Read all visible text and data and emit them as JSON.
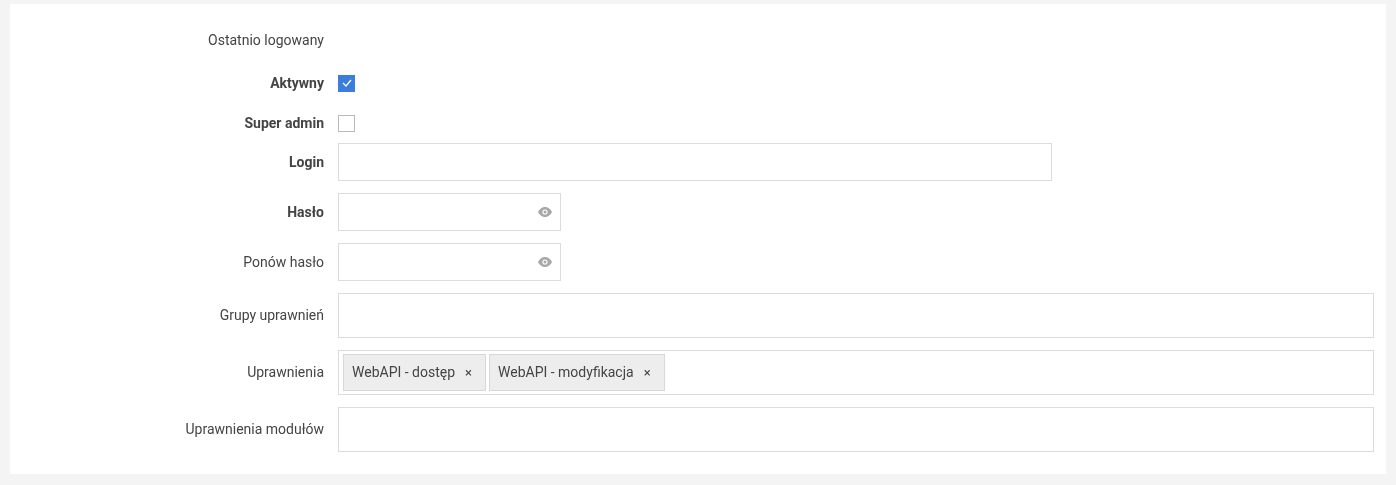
{
  "form": {
    "fields": [
      {
        "kind": "text",
        "label": "Ostatnio logowany",
        "required": false
      },
      {
        "kind": "checkbox",
        "label": "Aktywny",
        "required": true,
        "checked": true
      },
      {
        "kind": "checkbox",
        "label": "Super admin",
        "required": true,
        "checked": false
      },
      {
        "kind": "input",
        "label": "Login",
        "required": true
      },
      {
        "kind": "password",
        "label": "Hasło",
        "required": true
      },
      {
        "kind": "password",
        "label": "Ponów hasło",
        "required": false
      },
      {
        "kind": "multiselect",
        "label": "Grupy uprawnień",
        "required": false
      },
      {
        "kind": "multiselect",
        "label": "Uprawnienia",
        "required": false,
        "tags": [
          {
            "label": "WebAPI - dostęp",
            "remove": "×"
          },
          {
            "label": "WebAPI - modyfikacja",
            "remove": "×"
          }
        ]
      },
      {
        "kind": "multiselect",
        "label": "Uprawnienia modułów",
        "required": false
      }
    ]
  }
}
